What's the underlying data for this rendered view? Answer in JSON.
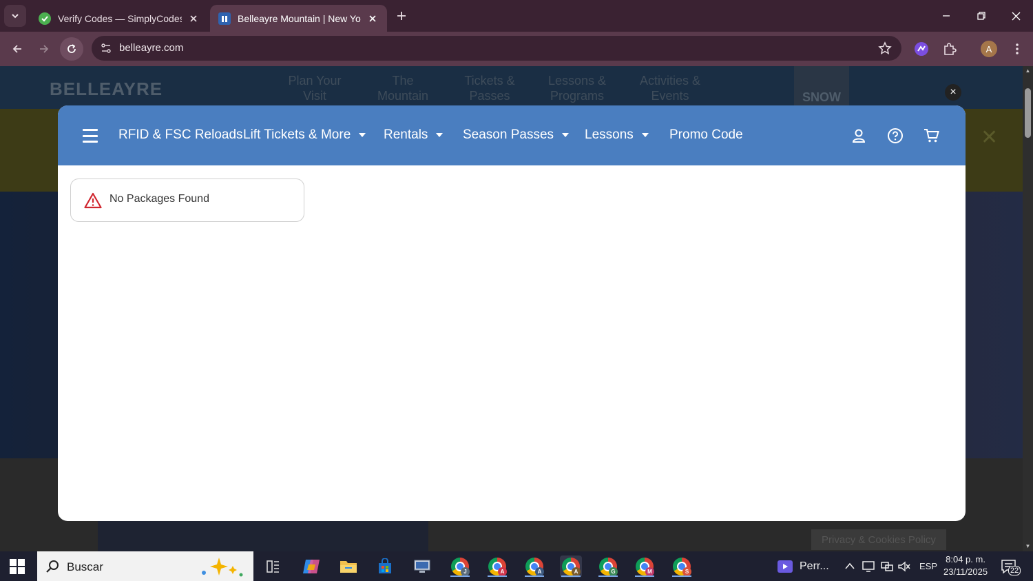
{
  "browser": {
    "tabs": [
      {
        "title": "Verify Codes — SimplyCodes",
        "active": false
      },
      {
        "title": "Belleayre Mountain | New York's",
        "active": true
      }
    ],
    "url": "belleayre.com",
    "profile_initial": "A"
  },
  "background_page": {
    "logo": "BELLEAYRE",
    "nav": [
      {
        "line1": "Plan Your",
        "line2": "Visit"
      },
      {
        "line1": "The",
        "line2": "Mountain"
      },
      {
        "line1": "Tickets &",
        "line2": "Passes"
      },
      {
        "line1": "Lessons &",
        "line2": "Programs"
      },
      {
        "line1": "Activities &",
        "line2": "Events"
      }
    ],
    "snow_label": "SNOW",
    "privacy_link": "Privacy & Cookies Policy",
    "overlay_close": "×",
    "banner_close": "✕"
  },
  "modal": {
    "nav": {
      "items": [
        {
          "label": "RFID & FSC Reloads",
          "dropdown": false
        },
        {
          "label": "Lift Tickets & More",
          "dropdown": true
        },
        {
          "label": "Rentals",
          "dropdown": true
        },
        {
          "label": "Season Passes",
          "dropdown": true
        },
        {
          "label": "Lessons",
          "dropdown": true
        },
        {
          "label": "Promo Code",
          "dropdown": false
        }
      ],
      "icons": [
        "account-icon",
        "help-icon",
        "cart-icon"
      ]
    },
    "alert": {
      "message": "No Packages Found",
      "icon": "warning-icon"
    }
  },
  "taskbar": {
    "search_placeholder": "Buscar",
    "chrome_badges": [
      "J",
      "A",
      "A",
      "A",
      "G",
      "M",
      "S"
    ],
    "badge_colors": [
      "#5a6b7a",
      "#d2344a",
      "#3d5a80",
      "#7a5c2e",
      "#3c8a56",
      "#c23a6a",
      "#d9523a"
    ],
    "media_label": "Perr...",
    "language": "ESP",
    "time": "8:04 p. m.",
    "date": "23/11/2025",
    "notification_count": "22"
  },
  "colors": {
    "modal_nav": "#4a7ec0",
    "warning": "#d0262f",
    "chrome_frame": "#3a2232",
    "toolbar": "#5a3a4c"
  }
}
